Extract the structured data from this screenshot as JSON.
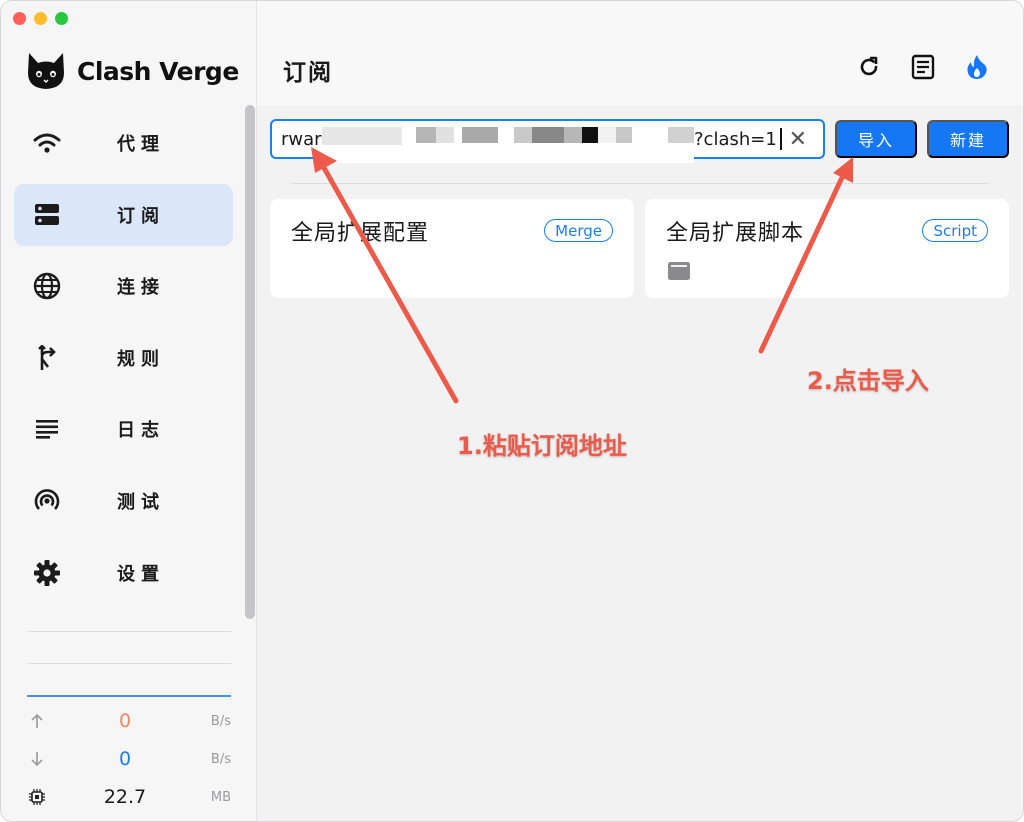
{
  "app": {
    "name": "Clash Verge"
  },
  "sidebar": {
    "items": [
      {
        "label": "代理",
        "icon": "wifi-icon",
        "active": false
      },
      {
        "label": "订阅",
        "icon": "storage-icon",
        "active": true
      },
      {
        "label": "连接",
        "icon": "globe-icon",
        "active": false
      },
      {
        "label": "规则",
        "icon": "fork-icon",
        "active": false
      },
      {
        "label": "日志",
        "icon": "lines-icon",
        "active": false
      },
      {
        "label": "测试",
        "icon": "radar-icon",
        "active": false
      },
      {
        "label": "设置",
        "icon": "gear-icon",
        "active": false
      }
    ],
    "traffic": {
      "upload": {
        "value": "0",
        "unit": "B/s",
        "color": "#f08a5d"
      },
      "download": {
        "value": "0",
        "unit": "B/s",
        "color": "#1a7ff0"
      },
      "memory": {
        "value": "22.7",
        "unit": "MB"
      }
    }
  },
  "header": {
    "title": "订阅",
    "icons": [
      "refresh-icon",
      "document-icon",
      "flame-icon"
    ]
  },
  "subscription": {
    "url_value_start": "rwar",
    "url_value_end": "?clash=1",
    "import_label": "导入",
    "new_label": "新建"
  },
  "cards": [
    {
      "title": "全局扩展配置",
      "tag": "Merge"
    },
    {
      "title": "全局扩展脚本",
      "tag": "Script"
    }
  ],
  "annotations": {
    "step1": "1.粘贴订阅地址",
    "step2": "2.点击导入"
  },
  "colors": {
    "accent": "#1677f5",
    "annotation": "#ee5a4a",
    "active_nav": "#dbe6f8"
  }
}
